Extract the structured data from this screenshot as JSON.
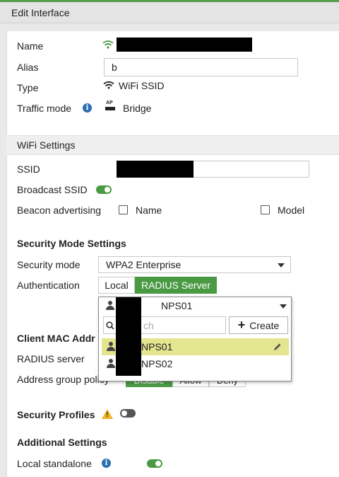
{
  "window": {
    "title": "Edit Interface"
  },
  "general": {
    "name_label": "Name",
    "alias_label": "Alias",
    "alias_value": "b",
    "type_label": "Type",
    "type_value": "WiFi SSID",
    "traffic_mode_label": "Traffic mode",
    "traffic_mode_value": "Bridge",
    "ap_badge": "AP"
  },
  "wifi_settings": {
    "title": "WiFi Settings",
    "ssid_label": "SSID",
    "broadcast_label": "Broadcast SSID",
    "broadcast_enabled": true,
    "beacon_label": "Beacon advertising",
    "beacon_options": [
      "Name",
      "Model"
    ]
  },
  "security_mode": {
    "title": "Security Mode Settings",
    "mode_label": "Security mode",
    "mode_value": "WPA2 Enterprise",
    "auth_label": "Authentication",
    "auth_options": [
      "Local",
      "RADIUS Server"
    ],
    "auth_selected": "RADIUS Server",
    "radius_selected": "NPS01"
  },
  "client_mac": {
    "title": "Client MAC Addr",
    "radius_label": "RADIUS server",
    "address_group_label": "Address group policy",
    "address_group_options": [
      "Disable",
      "Allow",
      "Deny"
    ]
  },
  "radius_dropdown": {
    "search_placeholder": "Search",
    "search_visible_text": "ch",
    "create_label": "Create",
    "items": [
      "NPS01",
      "NPS02"
    ]
  },
  "security_profiles": {
    "title": "Security Profiles",
    "enabled": false
  },
  "additional": {
    "title": "Additional Settings",
    "local_standalone_label": "Local standalone",
    "local_standalone_enabled": true
  },
  "colors": {
    "accent": "#4a9a44",
    "info": "#2b6fb3",
    "warning": "#f0b323",
    "highlight": "#e3e58f"
  }
}
